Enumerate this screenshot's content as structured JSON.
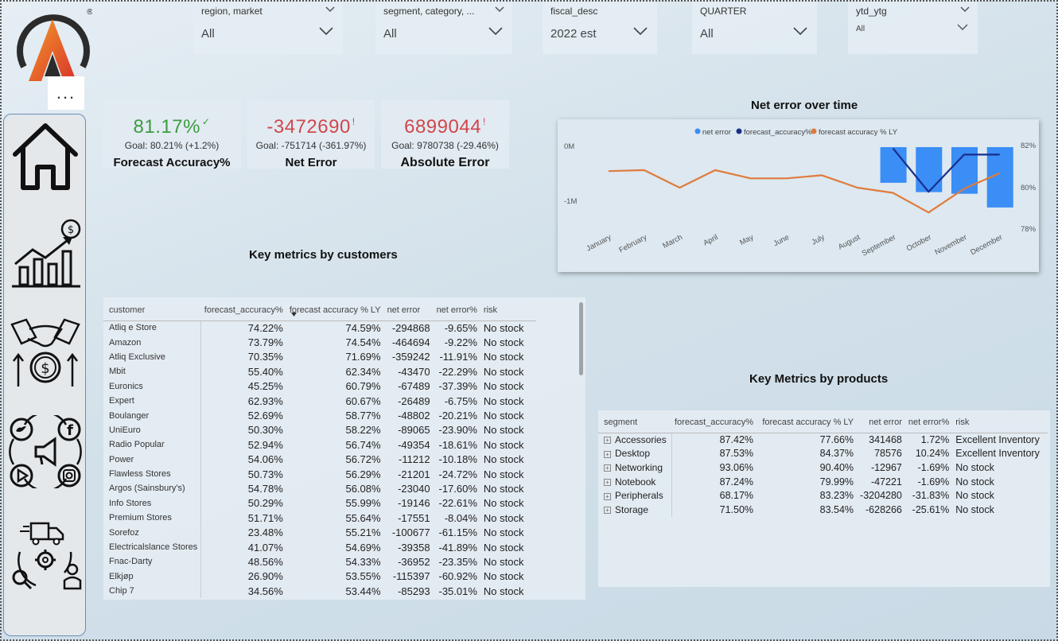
{
  "slicers": [
    {
      "label": "region, market",
      "value": "All"
    },
    {
      "label": "segment, category, ...",
      "value": "All"
    },
    {
      "label": "fiscal_desc",
      "value": "2022 est"
    },
    {
      "label": "QUARTER",
      "value": "All"
    },
    {
      "label": "ytd_ytg",
      "value": "All"
    }
  ],
  "more_options": "...",
  "nav_icons": [
    "home-icon",
    "sales-growth-icon",
    "finance-handshake-icon",
    "social-media-icon",
    "supply-chain-icon"
  ],
  "kpis": {
    "forecast_accuracy": {
      "value": "81.17%",
      "goal": "Goal: 80.21% (+1.2%)",
      "label": "Forecast Accuracy%",
      "mark": "✓"
    },
    "net_error": {
      "value": "-3472690",
      "goal": "Goal: -751714 (-361.97%)",
      "label": "Net Error",
      "mark": "!"
    },
    "absolute_error": {
      "value": "6899044",
      "goal": "Goal: 9780738 (-29.46%)",
      "label": "Absolute Error",
      "mark": "!"
    }
  },
  "colors": {
    "good": "#3d9b40",
    "bad": "#d0474c",
    "bar": "#3a8ef5",
    "line_dark": "#1a2e8c",
    "line_orange": "#e07b3c"
  },
  "chart_data": {
    "type": "bar",
    "title": "Net error over time",
    "legend_position": "top-center",
    "categories": [
      "January",
      "February",
      "March",
      "April",
      "May",
      "June",
      "July",
      "August",
      "September",
      "October",
      "November",
      "December"
    ],
    "series": [
      {
        "name": "net error",
        "type": "bar",
        "axis": "left",
        "values": [
          null,
          null,
          null,
          null,
          null,
          null,
          null,
          null,
          -650000,
          -820000,
          -850000,
          -1100000
        ]
      },
      {
        "name": "forecast_accuracy%",
        "type": "line",
        "axis": "right",
        "values": [
          null,
          null,
          null,
          null,
          null,
          null,
          null,
          null,
          81.9,
          79.8,
          81.6,
          81.6
        ]
      },
      {
        "name": "forecast accuracy % LY",
        "type": "line",
        "axis": "right",
        "values": [
          80.8,
          80.85,
          80.0,
          80.85,
          80.45,
          80.45,
          80.6,
          80.0,
          79.75,
          78.8,
          79.95,
          80.7
        ]
      }
    ],
    "y_left": {
      "ticks": [
        "0M",
        "-1M"
      ],
      "range": [
        -2000000,
        0
      ]
    },
    "y_right": {
      "ticks": [
        "82%",
        "80%",
        "78%"
      ],
      "range": [
        78,
        82
      ]
    }
  },
  "customers_title": "Key metrics by customers",
  "customers": {
    "headers": [
      "customer",
      "forecast_accuracy%",
      "forecast accuracy % LY",
      "net error",
      "net error%",
      "risk"
    ],
    "rows": [
      [
        "Atliq e Store",
        "74.22%",
        "74.59%",
        "-294868",
        "-9.65%",
        "No stock"
      ],
      [
        "Amazon",
        "73.79%",
        "74.54%",
        "-464694",
        "-9.22%",
        "No stock"
      ],
      [
        "Atliq Exclusive",
        "70.35%",
        "71.69%",
        "-359242",
        "-11.91%",
        "No stock"
      ],
      [
        "Mbit",
        "55.40%",
        "62.34%",
        "-43470",
        "-22.29%",
        "No stock"
      ],
      [
        "Euronics",
        "45.25%",
        "60.79%",
        "-67489",
        "-37.39%",
        "No stock"
      ],
      [
        "Expert",
        "62.93%",
        "60.67%",
        "-26489",
        "-6.75%",
        "No stock"
      ],
      [
        "Boulanger",
        "52.69%",
        "58.77%",
        "-48802",
        "-20.21%",
        "No stock"
      ],
      [
        "UniEuro",
        "50.30%",
        "58.22%",
        "-89065",
        "-23.90%",
        "No stock"
      ],
      [
        "Radio Popular",
        "52.94%",
        "56.74%",
        "-49354",
        "-18.61%",
        "No stock"
      ],
      [
        "Power",
        "54.06%",
        "56.72%",
        "-11212",
        "-10.18%",
        "No stock"
      ],
      [
        "Flawless Stores",
        "50.73%",
        "56.29%",
        "-21201",
        "-24.72%",
        "No stock"
      ],
      [
        "Argos (Sainsbury's)",
        "54.78%",
        "56.08%",
        "-23040",
        "-17.60%",
        "No stock"
      ],
      [
        "Info Stores",
        "50.29%",
        "55.99%",
        "-19146",
        "-22.61%",
        "No stock"
      ],
      [
        "Premium Stores",
        "51.71%",
        "55.64%",
        "-17551",
        "-8.04%",
        "No stock"
      ],
      [
        "Sorefoz",
        "23.48%",
        "55.21%",
        "-100677",
        "-61.15%",
        "No stock"
      ],
      [
        "Electricalslance Stores",
        "41.07%",
        "54.69%",
        "-39358",
        "-41.89%",
        "No stock"
      ],
      [
        "Fnac-Darty",
        "48.56%",
        "54.33%",
        "-36952",
        "-23.35%",
        "No stock"
      ],
      [
        "Elkjøp",
        "26.90%",
        "53.55%",
        "-115397",
        "-60.92%",
        "No stock"
      ],
      [
        "Chip 7",
        "34.56%",
        "53.44%",
        "-85293",
        "-35.01%",
        "No stock"
      ]
    ]
  },
  "products_title": "Key Metrics by products",
  "products": {
    "headers": [
      "segment",
      "forecast_accuracy%",
      "forecast accuracy % LY",
      "net error",
      "net error%",
      "risk"
    ],
    "rows": [
      [
        "Accessories",
        "87.42%",
        "77.66%",
        "341468",
        "1.72%",
        "Excellent Inventory"
      ],
      [
        "Desktop",
        "87.53%",
        "84.37%",
        "78576",
        "10.24%",
        "Excellent Inventory"
      ],
      [
        "Networking",
        "93.06%",
        "90.40%",
        "-12967",
        "-1.69%",
        "No stock"
      ],
      [
        "Notebook",
        "87.24%",
        "79.99%",
        "-47221",
        "-1.69%",
        "No stock"
      ],
      [
        "Peripherals",
        "68.17%",
        "83.23%",
        "-3204280",
        "-31.83%",
        "No stock"
      ],
      [
        "Storage",
        "71.50%",
        "83.54%",
        "-628266",
        "-25.61%",
        "No stock"
      ]
    ]
  }
}
